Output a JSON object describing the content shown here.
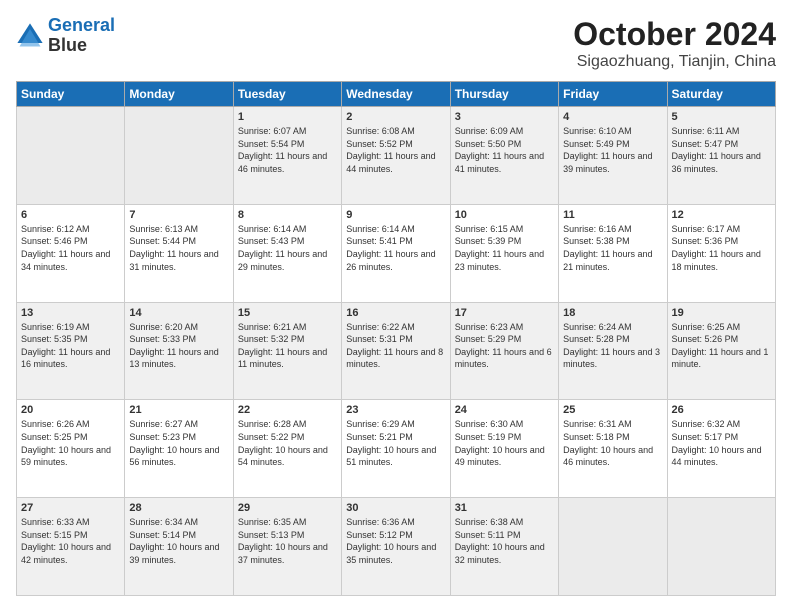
{
  "header": {
    "logo_line1": "General",
    "logo_line2": "Blue",
    "month": "October 2024",
    "location": "Sigaozhuang, Tianjin, China"
  },
  "weekdays": [
    "Sunday",
    "Monday",
    "Tuesday",
    "Wednesday",
    "Thursday",
    "Friday",
    "Saturday"
  ],
  "weeks": [
    [
      {
        "day": "",
        "info": ""
      },
      {
        "day": "",
        "info": ""
      },
      {
        "day": "1",
        "info": "Sunrise: 6:07 AM\nSunset: 5:54 PM\nDaylight: 11 hours and 46 minutes."
      },
      {
        "day": "2",
        "info": "Sunrise: 6:08 AM\nSunset: 5:52 PM\nDaylight: 11 hours and 44 minutes."
      },
      {
        "day": "3",
        "info": "Sunrise: 6:09 AM\nSunset: 5:50 PM\nDaylight: 11 hours and 41 minutes."
      },
      {
        "day": "4",
        "info": "Sunrise: 6:10 AM\nSunset: 5:49 PM\nDaylight: 11 hours and 39 minutes."
      },
      {
        "day": "5",
        "info": "Sunrise: 6:11 AM\nSunset: 5:47 PM\nDaylight: 11 hours and 36 minutes."
      }
    ],
    [
      {
        "day": "6",
        "info": "Sunrise: 6:12 AM\nSunset: 5:46 PM\nDaylight: 11 hours and 34 minutes."
      },
      {
        "day": "7",
        "info": "Sunrise: 6:13 AM\nSunset: 5:44 PM\nDaylight: 11 hours and 31 minutes."
      },
      {
        "day": "8",
        "info": "Sunrise: 6:14 AM\nSunset: 5:43 PM\nDaylight: 11 hours and 29 minutes."
      },
      {
        "day": "9",
        "info": "Sunrise: 6:14 AM\nSunset: 5:41 PM\nDaylight: 11 hours and 26 minutes."
      },
      {
        "day": "10",
        "info": "Sunrise: 6:15 AM\nSunset: 5:39 PM\nDaylight: 11 hours and 23 minutes."
      },
      {
        "day": "11",
        "info": "Sunrise: 6:16 AM\nSunset: 5:38 PM\nDaylight: 11 hours and 21 minutes."
      },
      {
        "day": "12",
        "info": "Sunrise: 6:17 AM\nSunset: 5:36 PM\nDaylight: 11 hours and 18 minutes."
      }
    ],
    [
      {
        "day": "13",
        "info": "Sunrise: 6:19 AM\nSunset: 5:35 PM\nDaylight: 11 hours and 16 minutes."
      },
      {
        "day": "14",
        "info": "Sunrise: 6:20 AM\nSunset: 5:33 PM\nDaylight: 11 hours and 13 minutes."
      },
      {
        "day": "15",
        "info": "Sunrise: 6:21 AM\nSunset: 5:32 PM\nDaylight: 11 hours and 11 minutes."
      },
      {
        "day": "16",
        "info": "Sunrise: 6:22 AM\nSunset: 5:31 PM\nDaylight: 11 hours and 8 minutes."
      },
      {
        "day": "17",
        "info": "Sunrise: 6:23 AM\nSunset: 5:29 PM\nDaylight: 11 hours and 6 minutes."
      },
      {
        "day": "18",
        "info": "Sunrise: 6:24 AM\nSunset: 5:28 PM\nDaylight: 11 hours and 3 minutes."
      },
      {
        "day": "19",
        "info": "Sunrise: 6:25 AM\nSunset: 5:26 PM\nDaylight: 11 hours and 1 minute."
      }
    ],
    [
      {
        "day": "20",
        "info": "Sunrise: 6:26 AM\nSunset: 5:25 PM\nDaylight: 10 hours and 59 minutes."
      },
      {
        "day": "21",
        "info": "Sunrise: 6:27 AM\nSunset: 5:23 PM\nDaylight: 10 hours and 56 minutes."
      },
      {
        "day": "22",
        "info": "Sunrise: 6:28 AM\nSunset: 5:22 PM\nDaylight: 10 hours and 54 minutes."
      },
      {
        "day": "23",
        "info": "Sunrise: 6:29 AM\nSunset: 5:21 PM\nDaylight: 10 hours and 51 minutes."
      },
      {
        "day": "24",
        "info": "Sunrise: 6:30 AM\nSunset: 5:19 PM\nDaylight: 10 hours and 49 minutes."
      },
      {
        "day": "25",
        "info": "Sunrise: 6:31 AM\nSunset: 5:18 PM\nDaylight: 10 hours and 46 minutes."
      },
      {
        "day": "26",
        "info": "Sunrise: 6:32 AM\nSunset: 5:17 PM\nDaylight: 10 hours and 44 minutes."
      }
    ],
    [
      {
        "day": "27",
        "info": "Sunrise: 6:33 AM\nSunset: 5:15 PM\nDaylight: 10 hours and 42 minutes."
      },
      {
        "day": "28",
        "info": "Sunrise: 6:34 AM\nSunset: 5:14 PM\nDaylight: 10 hours and 39 minutes."
      },
      {
        "day": "29",
        "info": "Sunrise: 6:35 AM\nSunset: 5:13 PM\nDaylight: 10 hours and 37 minutes."
      },
      {
        "day": "30",
        "info": "Sunrise: 6:36 AM\nSunset: 5:12 PM\nDaylight: 10 hours and 35 minutes."
      },
      {
        "day": "31",
        "info": "Sunrise: 6:38 AM\nSunset: 5:11 PM\nDaylight: 10 hours and 32 minutes."
      },
      {
        "day": "",
        "info": ""
      },
      {
        "day": "",
        "info": ""
      }
    ]
  ]
}
